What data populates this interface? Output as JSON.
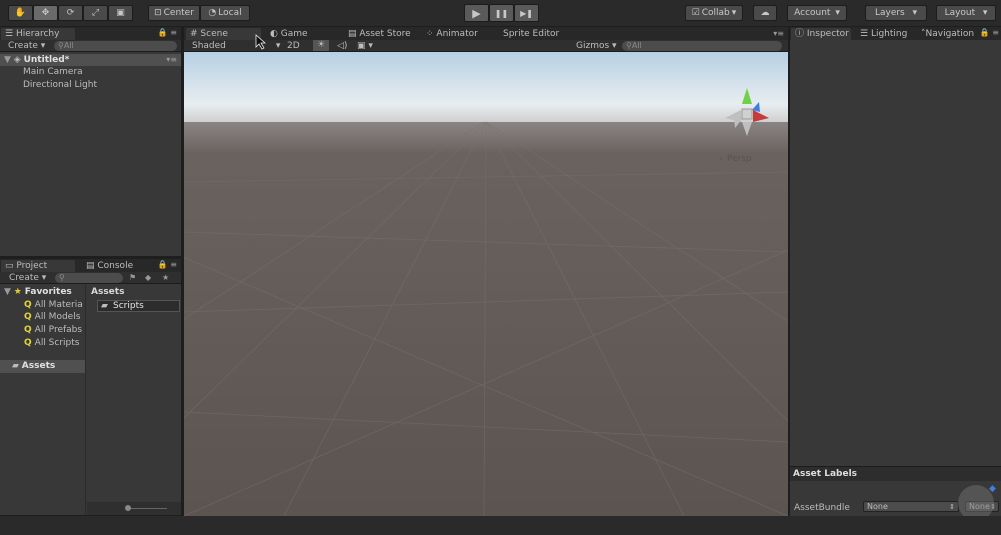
{
  "toolbar": {
    "tools": [
      {
        "icon": "hand-icon",
        "glyph": "✋"
      },
      {
        "icon": "move-icon",
        "glyph": "✥"
      },
      {
        "icon": "rotate-icon",
        "glyph": "⟳"
      },
      {
        "icon": "scale-icon",
        "glyph": "⤢"
      },
      {
        "icon": "rect-tool-icon",
        "glyph": "▣"
      }
    ],
    "pivot": "Center",
    "space": "Local",
    "play_glyph": "▶",
    "pause_glyph": "❚❚",
    "step_glyph": "▶❚",
    "collab": "Collab",
    "cloud_glyph": "☁",
    "account": "Account",
    "layers": "Layers",
    "layout": "Layout"
  },
  "hierarchy": {
    "tab": "Hierarchy",
    "create": "Create",
    "search_placeholder": "All",
    "scene_name": "Untitled*",
    "items": [
      "Main Camera",
      "Directional Light"
    ]
  },
  "scene_tabs": {
    "scene": "Scene",
    "game": "Game",
    "asset_store": "Asset Store",
    "animator": "Animator",
    "sprite_editor": "Sprite Editor"
  },
  "scene_toolbar": {
    "shading": "Shaded",
    "mode_2d": "2D",
    "gizmos": "Gizmos",
    "search_placeholder": "All"
  },
  "scene_view": {
    "projection": "Persp"
  },
  "project": {
    "tab": "Project",
    "console_tab": "Console",
    "create": "Create",
    "favorites_label": "Favorites",
    "favorites": [
      "All Materia",
      "All Models",
      "All Prefabs",
      "All Scripts"
    ],
    "assets_label": "Assets",
    "breadcrumb": "Assets",
    "folder_name": "Scripts"
  },
  "inspector": {
    "tab": "Inspector",
    "lighting_tab": "Lighting",
    "navigation_tab": "Navigation",
    "asset_labels": "Asset Labels",
    "asset_bundle_label": "AssetBundle",
    "asset_bundle_value": "None",
    "variant_value": "None"
  },
  "colors": {
    "sky_top": "#b9d3e6",
    "horizon": "#e9eef1",
    "ground": "#5e5551",
    "panel": "#383838",
    "gizmo_y": "#6fd14a",
    "gizmo_x": "#c53b3b",
    "gizmo_z": "#3f7fe0"
  }
}
